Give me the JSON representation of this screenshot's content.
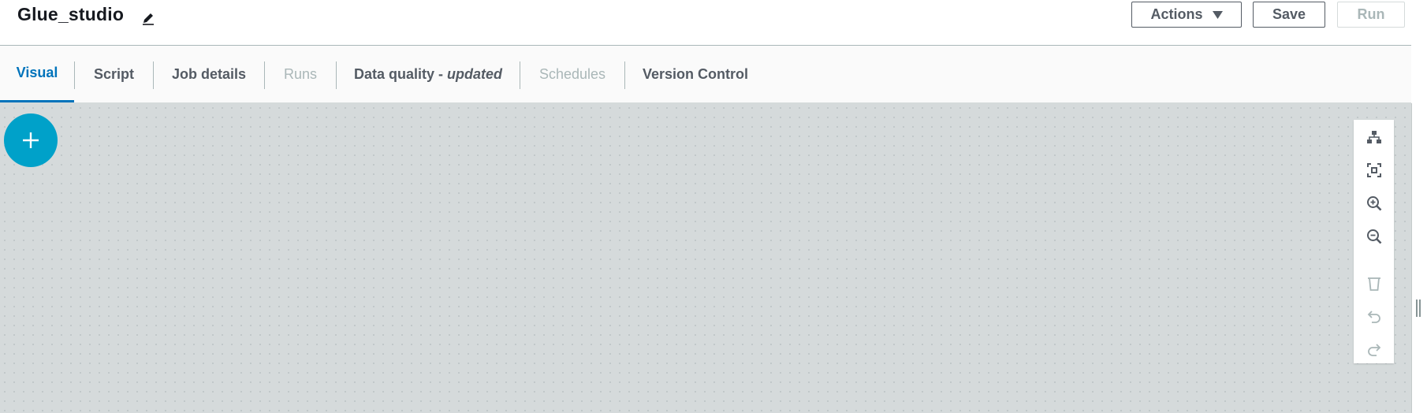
{
  "header": {
    "job_title": "Glue_studio",
    "edit_icon": "pencil-icon",
    "actions_label": "Actions",
    "save_label": "Save",
    "run_label": "Run"
  },
  "tabs": [
    {
      "label": "Visual",
      "state": "active"
    },
    {
      "label": "Script",
      "state": "enabled"
    },
    {
      "label": "Job details",
      "state": "enabled"
    },
    {
      "label": "Runs",
      "state": "disabled"
    },
    {
      "label": "Data quality - ",
      "suffix": "updated",
      "state": "enabled"
    },
    {
      "label": "Schedules",
      "state": "disabled"
    },
    {
      "label": "Version Control",
      "state": "enabled"
    }
  ],
  "canvas": {
    "add_node_icon": "plus-icon",
    "toolbar": [
      {
        "icon": "layout-icon",
        "enabled": true
      },
      {
        "icon": "fit-to-screen-icon",
        "enabled": true
      },
      {
        "icon": "zoom-in-icon",
        "enabled": true
      },
      {
        "icon": "zoom-out-icon",
        "enabled": true
      },
      {
        "icon": "delete-icon",
        "enabled": false
      },
      {
        "icon": "undo-icon",
        "enabled": false
      },
      {
        "icon": "redo-icon",
        "enabled": false
      }
    ]
  },
  "colors": {
    "accent": "#0073bb",
    "add_button": "#00a1c9",
    "canvas_bg": "#d5dadb",
    "disabled_text": "#aab7b8",
    "text": "#545b64"
  }
}
